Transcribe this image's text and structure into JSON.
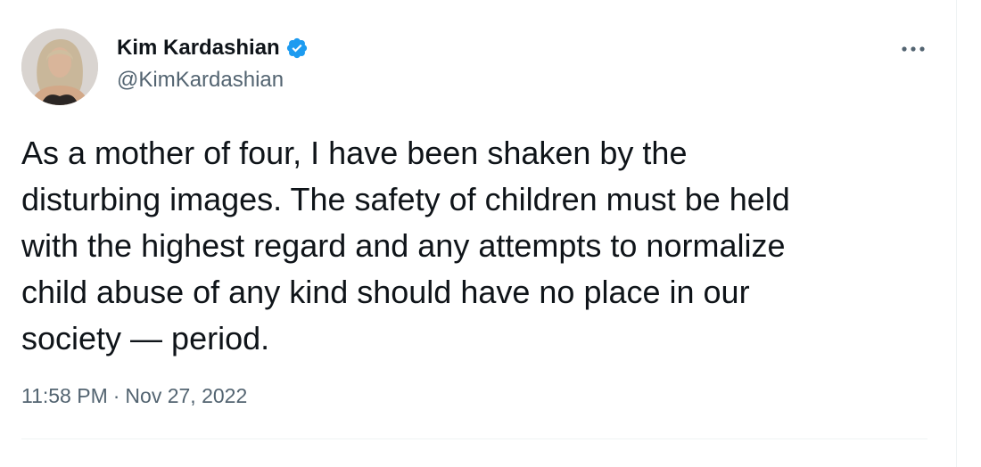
{
  "tweet": {
    "author": {
      "display_name": "Kim Kardashian",
      "handle": "@KimKardashian",
      "verified": true,
      "verified_icon": "verified-badge-icon",
      "avatar": "profile-avatar"
    },
    "text": "As a mother of four, I have been shaken by the\ndisturbing images. The safety of children must be held\nwith the highest regard and any attempts to normalize\nchild abuse of any kind should have no place in our\nsociety — period.",
    "time": "11:58 PM",
    "separator": "·",
    "date": "Nov 27, 2022",
    "more_icon": "more-options-icon"
  },
  "colors": {
    "text_primary": "#0f1419",
    "text_secondary": "#536471",
    "verified_blue": "#1d9bf0",
    "border": "#eff3f4"
  }
}
